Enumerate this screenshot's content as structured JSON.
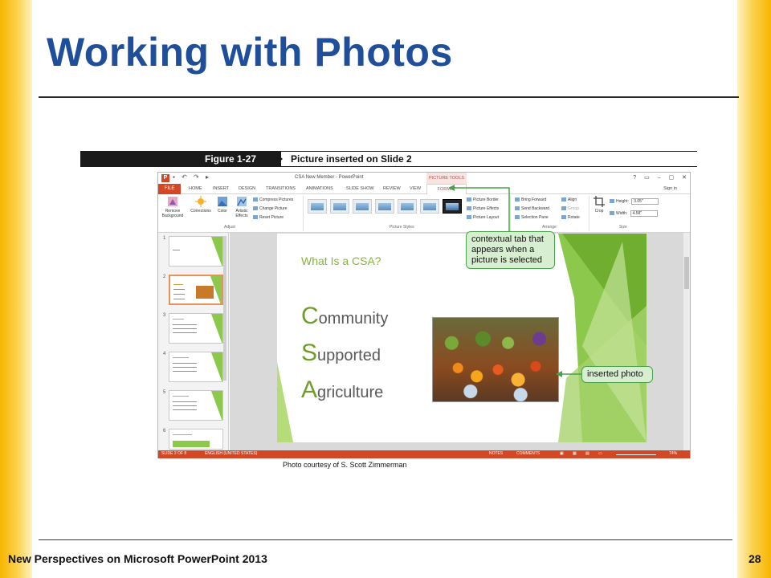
{
  "slide": {
    "title": "Working with Photos",
    "footer_left": "New Perspectives on Microsoft PowerPoint 2013",
    "page_number": "28"
  },
  "figure": {
    "number": "Figure 1-27",
    "caption": "Picture inserted on Slide 2",
    "credit": "Photo courtesy of S. Scott Zimmerman"
  },
  "window": {
    "title": "CSA New Member - PowerPoint",
    "picture_tools": "PICTURE TOOLS",
    "sign_in": "Sign in",
    "controls": [
      "?",
      "▭",
      "–",
      "▢",
      "✕"
    ]
  },
  "tabs": [
    "FILE",
    "HOME",
    "INSERT",
    "DESIGN",
    "TRANSITIONS",
    "ANIMATIONS",
    "SLIDE SHOW",
    "REVIEW",
    "VIEW",
    "FORMAT"
  ],
  "ribbon": {
    "remove_background": "Remove Background",
    "corrections": "Corrections",
    "color": "Color",
    "artistic_effects": "Artistic Effects",
    "compress_pictures": "Compress Pictures",
    "change_picture": "Change Picture",
    "reset_picture": "Reset Picture",
    "group_adjust": "Adjust",
    "group_picture_styles": "Picture Styles",
    "picture_border": "Picture Border",
    "picture_effects": "Picture Effects",
    "picture_layout": "Picture Layout",
    "bring_forward": "Bring Forward",
    "send_backward": "Send Backward",
    "selection_pane": "Selection Pane",
    "align": "Align",
    "group": "Group",
    "rotate": "Rotate",
    "group_arrange": "Arrange",
    "crop": "Crop",
    "height_label": "Height:",
    "height_value": "3.05\"",
    "width_label": "Width:",
    "width_value": "4.58\"",
    "group_size": "Size"
  },
  "thumbnails": [
    "1",
    "2",
    "3",
    "4",
    "5",
    "6"
  ],
  "slide_content": {
    "heading": "What Is a CSA?",
    "lines": [
      {
        "initial": "C",
        "rest": "ommunity"
      },
      {
        "initial": "S",
        "rest": "upported"
      },
      {
        "initial": "A",
        "rest": "griculture"
      }
    ]
  },
  "statusbar": {
    "slide_info": "SLIDE 2 OF 8",
    "language": "ENGLISH (UNITED STATES)",
    "notes": "NOTES",
    "comments": "COMMENTS",
    "zoom": "74%"
  },
  "callouts": {
    "contextual_tab": "contextual tab that appears when a picture is selected",
    "inserted_photo": "inserted photo"
  },
  "colors": {
    "title_blue": "#1f4e9a",
    "ppt_orange": "#d24726",
    "slide_green": "#8cc84b",
    "callout_fill": "#d7efd0",
    "callout_border": "#4aa24a"
  }
}
